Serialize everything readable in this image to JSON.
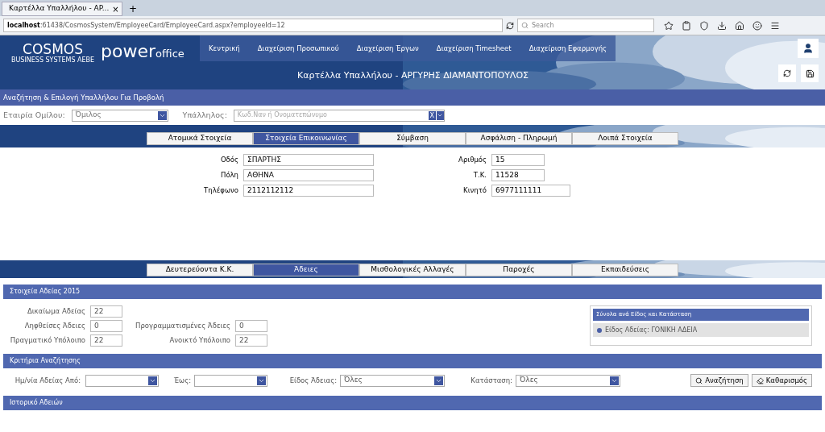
{
  "browser": {
    "tab_title": "Καρτέλλα Υπαλλήλου - AP...",
    "tab_close": "×",
    "new_tab": "+",
    "url_host": "localhost",
    "url_rest": ":61438/CosmosSystem/EmployeeCard/EmployeeCard.aspx?employeeId=12",
    "search_placeholder": "Search"
  },
  "header": {
    "logo": "COSMOS",
    "logo_sub": "BUSINESS SYSTEMS AEBE",
    "product": "power",
    "product_suffix": "office",
    "title": "Καρτέλλα Υπαλλήλου - ΑΡΓΥΡΗΣ ΔΙΑΜΑΝΤΟΠΟΥΛΟΣ",
    "nav": [
      "Κεντρική",
      "Διαχείριση Προσωπικού",
      "Διαχείριση Έργων",
      "Διαχείριση Timesheet",
      "Διαχείριση Εφαρμογής"
    ]
  },
  "employee_search": {
    "title": "Αναζήτηση & Επιλογή Υπαλλήλου Για Προβολή",
    "company_label": "Εταιρία Ομίλου:",
    "company_value": "Όμιλος",
    "employee_label": "Υπάλληλος:",
    "employee_placeholder": "Κωδ.Ναν ή Ονοματεπώνυμο",
    "clear": "X"
  },
  "tabs_top": [
    {
      "label": "Ατομικά Στοιχεία",
      "selected": false
    },
    {
      "label": "Στοιχεία Επικοινωνίας",
      "selected": true
    },
    {
      "label": "Σύμβαση",
      "selected": false
    },
    {
      "label": "Ασφάλιση - Πληρωμή",
      "selected": false
    },
    {
      "label": "Λοιπά Στοιχεία",
      "selected": false
    }
  ],
  "contact": {
    "left": [
      {
        "label": "Οδός",
        "value": "ΣΠΑΡΤΗΣ"
      },
      {
        "label": "Πόλη",
        "value": "ΑΘΗΝΑ"
      },
      {
        "label": "Τηλέφωνο",
        "value": "2112112112"
      }
    ],
    "right": [
      {
        "label": "Αριθμός",
        "value": "15"
      },
      {
        "label": "Τ.Κ.",
        "value": "11528"
      },
      {
        "label": "Κινητό",
        "value": "6977111111"
      }
    ]
  },
  "tabs_bottom": [
    {
      "label": "Δευτερεύοντα Κ.Κ.",
      "selected": false
    },
    {
      "label": "Άδειες",
      "selected": true
    },
    {
      "label": "Μισθολογικές Αλλαγές",
      "selected": false
    },
    {
      "label": "Παροχές",
      "selected": false
    },
    {
      "label": "Εκπαιδεύσεις",
      "selected": false
    }
  ],
  "leave_info": {
    "title": "Στοιχεία Αδείας 2015",
    "left": [
      {
        "label": "Δικαίωμα Αδείας",
        "value": "22"
      },
      {
        "label": "Ληφθείσες Άδειες",
        "value": "0"
      },
      {
        "label": "Πραγματικό Υπόλοιπο",
        "value": "22"
      }
    ],
    "right": [
      {
        "label": "Προγραμματισμένες Άδειες",
        "value": "0"
      },
      {
        "label": "Ανοικτό Υπόλοιπο",
        "value": "22"
      }
    ],
    "totals_title": "Σύνολα ανά Είδος και Κατάσταση",
    "totals_item": "Είδος Αδείας: ΓΟΝΙΚΗ ΑΔΕΙΑ"
  },
  "criteria": {
    "title": "Κριτήρια Αναζήτησης",
    "fields": [
      {
        "label": "Ημ/νία Αδείας Από:"
      },
      {
        "label": "Έως:"
      },
      {
        "label": "Είδος Άδειας:",
        "value": "Όλες"
      },
      {
        "label": "Κατάσταση:",
        "value": "Όλες"
      }
    ],
    "search_button": "Αναζήτηση",
    "clear_button": "Καθαρισμός"
  },
  "history": {
    "title": "Ιστορικό Αδειών"
  }
}
